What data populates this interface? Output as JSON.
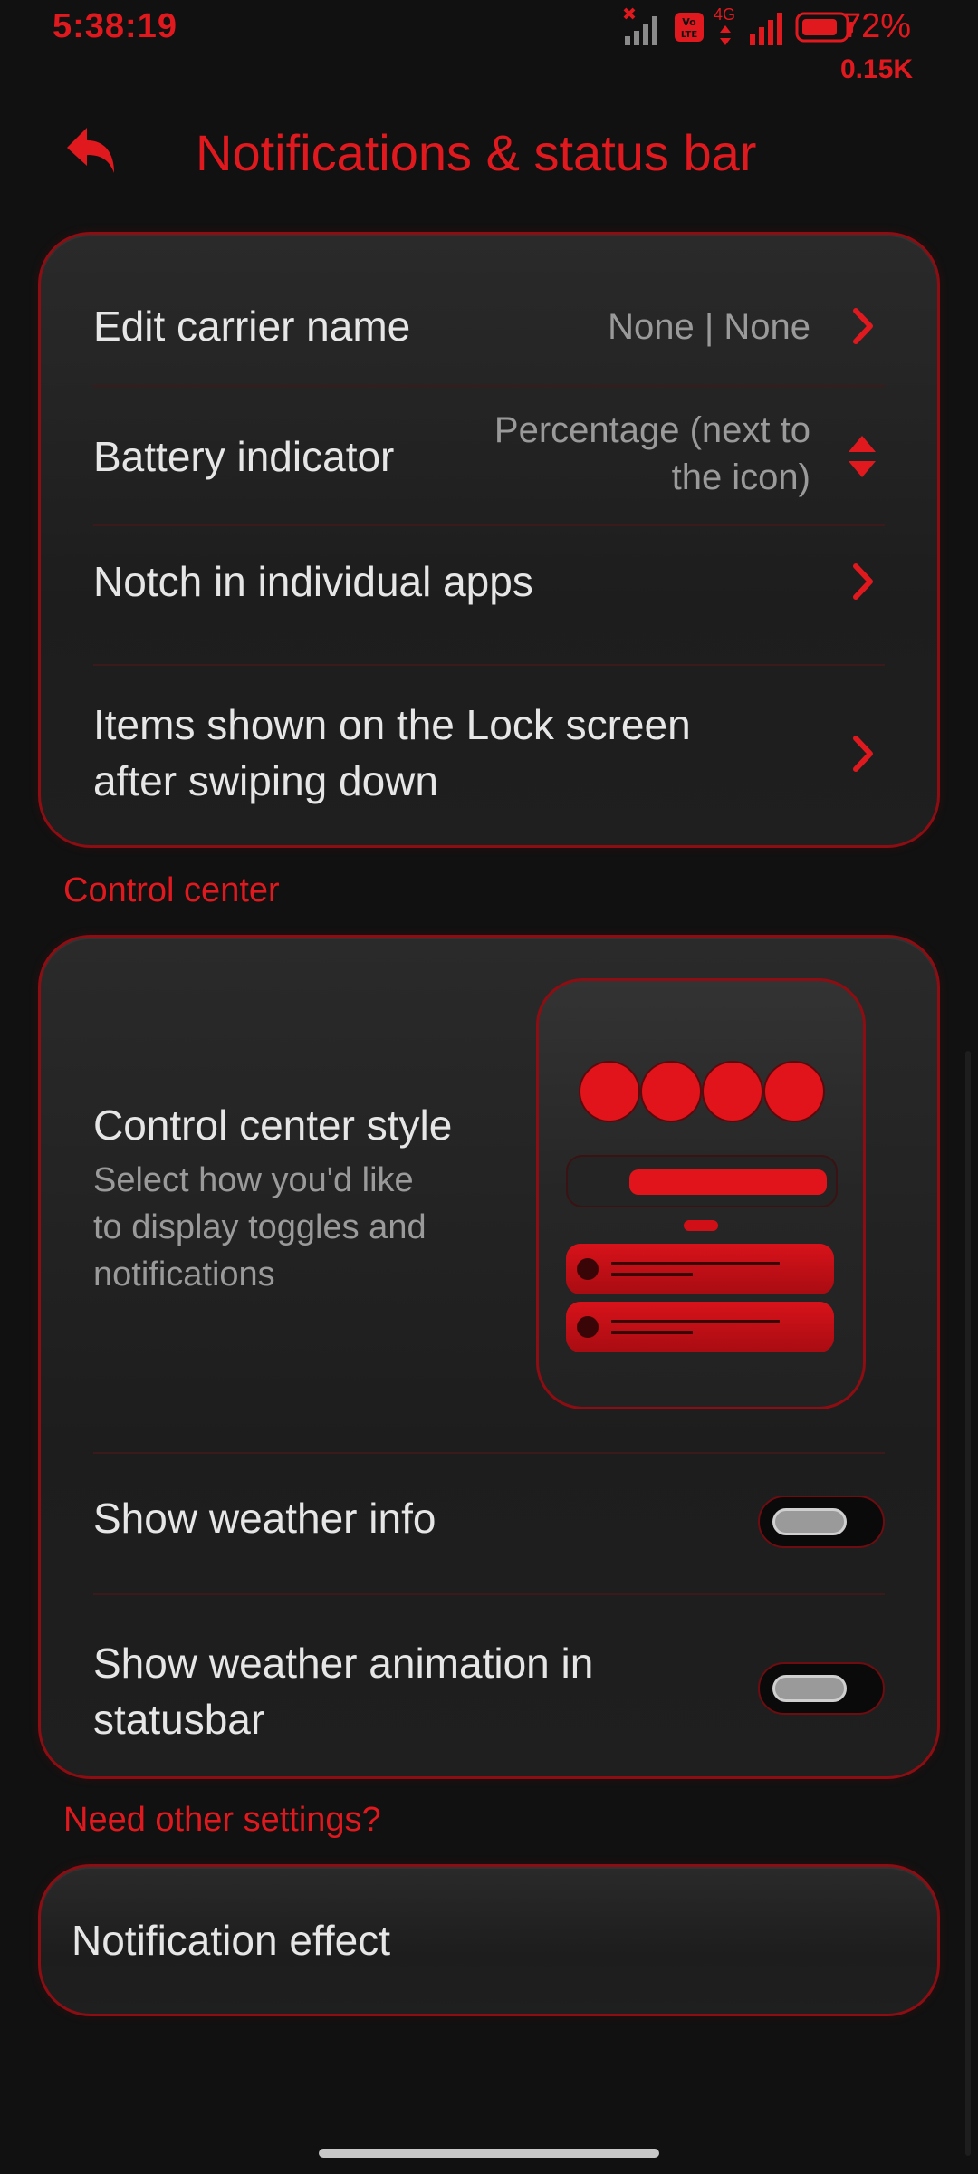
{
  "status_bar": {
    "time": "5:38:19",
    "battery_percent": "72%",
    "net_speed": "0.15K",
    "network_type": "4G",
    "volte_label": "Vo LTE",
    "battery_level": 0.72
  },
  "header": {
    "title": "Notifications & status bar",
    "back_icon": "back-arrow-icon"
  },
  "settings_card": {
    "items": [
      {
        "label": "Edit carrier name",
        "value": "None | None",
        "control": "chevron"
      },
      {
        "label": "Battery indicator",
        "value_line1": "Percentage (next to",
        "value_line2": "the icon)",
        "control": "dropdown"
      },
      {
        "label": "Notch in individual apps",
        "control": "chevron"
      },
      {
        "label_line1": "Items shown on the Lock screen",
        "label_line2": "after swiping down",
        "control": "chevron"
      }
    ]
  },
  "control_center": {
    "section_title": "Control center",
    "style": {
      "label": "Control center style",
      "desc_line1": "Select how you'd like",
      "desc_line2": "to display toggles and",
      "desc_line3": "notifications"
    },
    "weather_info": {
      "label": "Show weather info",
      "enabled": false
    },
    "weather_animation": {
      "label_line1": "Show weather animation in",
      "label_line2": "statusbar",
      "enabled": false
    }
  },
  "other": {
    "section_title": "Need other settings?",
    "items": [
      {
        "label": "Notification effect"
      }
    ]
  },
  "colors": {
    "accent": "#e0191f",
    "background": "#111111",
    "card": "#232323",
    "text": "#e6e6e6",
    "secondary_text": "#9a9a9a"
  }
}
